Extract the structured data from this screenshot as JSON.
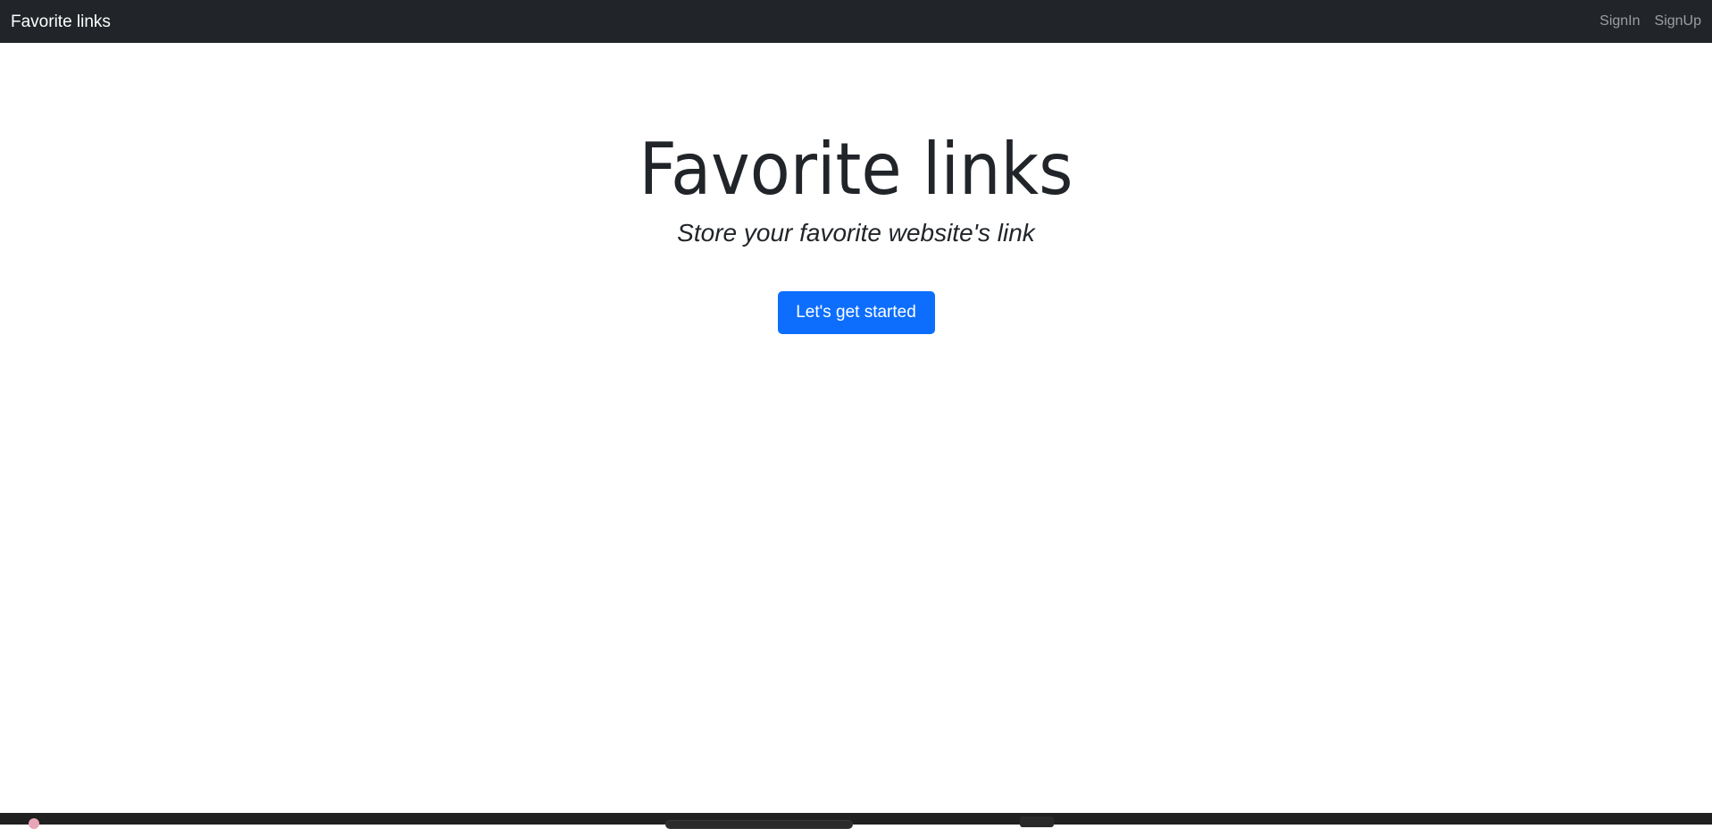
{
  "navbar": {
    "brand": "Favorite links",
    "links": [
      {
        "label": "SignIn"
      },
      {
        "label": "SignUp"
      }
    ],
    "background": "#212529"
  },
  "hero": {
    "title": "Favorite links",
    "subtitle": "Store your favorite website's link",
    "cta_label": "Let's get started",
    "cta_color": "#0d6efd"
  },
  "taskbar": {
    "icons": [
      "app-icon",
      "search-pill",
      "taskbar-button"
    ]
  }
}
